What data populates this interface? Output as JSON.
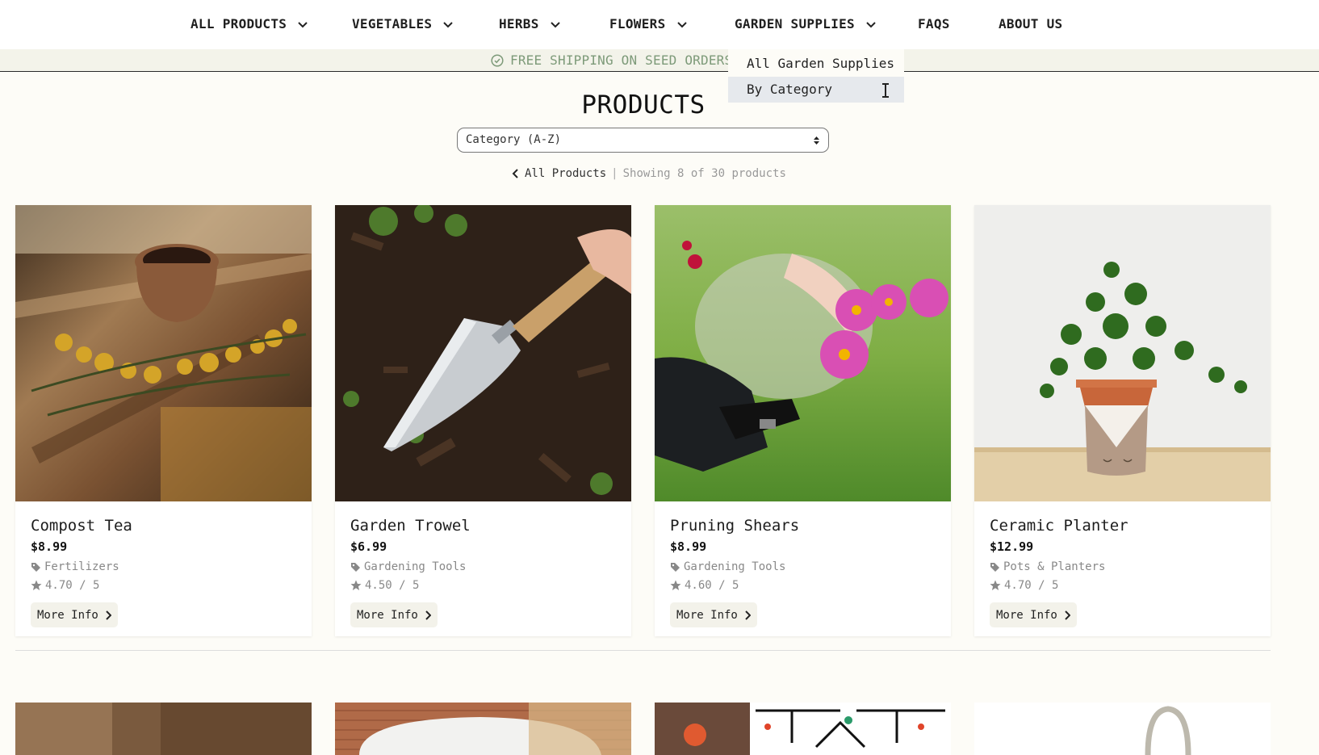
{
  "nav": {
    "items": [
      {
        "label": "ALL PRODUCTS",
        "has_dropdown": true
      },
      {
        "label": "VEGETABLES",
        "has_dropdown": true
      },
      {
        "label": "HERBS",
        "has_dropdown": true
      },
      {
        "label": "FLOWERS",
        "has_dropdown": true
      },
      {
        "label": "GARDEN SUPPLIES",
        "has_dropdown": true
      },
      {
        "label": "FAQS",
        "has_dropdown": false
      },
      {
        "label": "ABOUT US",
        "has_dropdown": false
      }
    ]
  },
  "banner": {
    "text": "FREE SHIPPING ON SEED ORDERS O",
    "icon": "check-circle-icon"
  },
  "dropdown": {
    "items": [
      {
        "label": "All Garden Supplies"
      },
      {
        "label": "By Category"
      }
    ]
  },
  "page": {
    "title": "PRODUCTS"
  },
  "sort": {
    "selected": "Category (A-Z)"
  },
  "breadcrumb": {
    "back_label": "All Products",
    "separator": "|",
    "count_text": "Showing 8 of 30 products"
  },
  "products": [
    {
      "name": "Compost Tea",
      "price": "$8.99",
      "category": "Fertilizers",
      "rating": "4.70 / 5",
      "button": "More Info"
    },
    {
      "name": "Garden Trowel",
      "price": "$6.99",
      "category": "Gardening Tools",
      "rating": "4.50 / 5",
      "button": "More Info"
    },
    {
      "name": "Pruning Shears",
      "price": "$8.99",
      "category": "Gardening Tools",
      "rating": "4.60 / 5",
      "button": "More Info"
    },
    {
      "name": "Ceramic Planter",
      "price": "$12.99",
      "category": "Pots & Planters",
      "rating": "4.70 / 5",
      "button": "More Info"
    }
  ],
  "colors": {
    "banner_text": "#7d9a79",
    "hover_bg": "#e6e9ed",
    "button_bg": "#f3f2ea"
  }
}
